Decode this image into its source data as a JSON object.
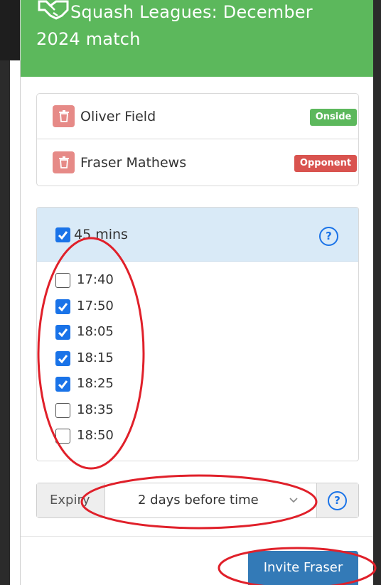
{
  "modal": {
    "title": "Squash Leagues: December 2024 match",
    "title_icon": "handshake-icon",
    "header_color": "#5cb85c"
  },
  "participants": [
    {
      "name": "Oliver Field",
      "badge": "Onside",
      "badge_color": "#5cb85c",
      "icon": "trash-icon"
    },
    {
      "name": "Fraser Mathews",
      "badge": "Opponent",
      "badge_color": "#d9534f",
      "icon": "trash-icon"
    }
  ],
  "duration": {
    "label": "45 mins",
    "checked": true,
    "help_icon": "question-circle-icon"
  },
  "time_slots": [
    {
      "time": "17:40",
      "checked": false
    },
    {
      "time": "17:50",
      "checked": true
    },
    {
      "time": "18:05",
      "checked": true
    },
    {
      "time": "18:15",
      "checked": true
    },
    {
      "time": "18:25",
      "checked": true
    },
    {
      "time": "18:35",
      "checked": false
    },
    {
      "time": "18:50",
      "checked": false
    }
  ],
  "expiry": {
    "label": "Expiry",
    "selected": "2 days before time",
    "help_icon": "question-circle-icon"
  },
  "invite_button": {
    "label": "Invite Fraser",
    "color": "#337ab7"
  },
  "annotation_color": "#e0202a"
}
